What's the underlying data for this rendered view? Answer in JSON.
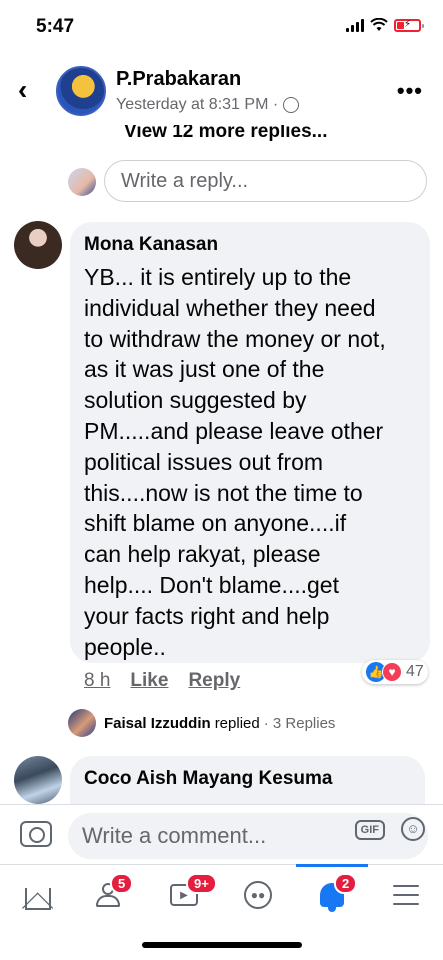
{
  "status_bar": {
    "time": "5:47"
  },
  "header": {
    "name": "P.Prabakaran",
    "subtitle": "Yesterday at 8:31 PM ·"
  },
  "thread": {
    "view_more_label": "View 12 more replies...",
    "reply_placeholder": "Write a reply..."
  },
  "comment": {
    "author": "Mona Kanasan",
    "text": "YB... it is entirely up to the\nindividual whether they need\nto withdraw the money or not,\nas it was just one of the\nsolution suggested by\nPM.....and please leave other\npolitical issues out from\nthis....now is not the time to\nshift blame on anyone....if\ncan help rakyat,  please\nhelp.... Don't blame....get\nyour facts right and help\npeople..",
    "time": "8 h",
    "like_label": "Like",
    "reply_label": "Reply",
    "reaction_count": "47",
    "replied_by": "Faisal Izzuddin",
    "replied_text": "replied",
    "reply_count": "· 3 Replies"
  },
  "next_comment": {
    "author": "Coco Aish Mayang Kesuma"
  },
  "composer": {
    "placeholder": "Write a comment...",
    "gif_label": "GIF"
  },
  "tab_bar": {
    "friends_badge": "5",
    "video_badge": "9+",
    "notifications_badge": "2"
  },
  "colors": {
    "accent": "#1877f2",
    "badge": "#e41e3f",
    "bubble": "#f0f2f5",
    "secondary_text": "#65676b"
  }
}
